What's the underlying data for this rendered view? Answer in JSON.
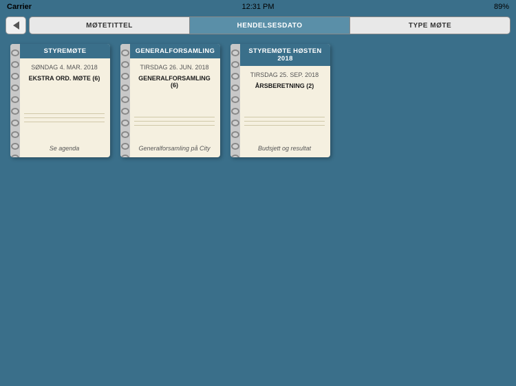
{
  "status_bar": {
    "carrier": "Carrier",
    "time": "12:31 PM",
    "battery": "89%"
  },
  "nav": {
    "back_label": "←",
    "tabs": [
      {
        "id": "motetittel",
        "label": "MØTETITTEL",
        "active": false
      },
      {
        "id": "hendelsesdato",
        "label": "HENDELSESDATO",
        "active": true
      },
      {
        "id": "type_mote",
        "label": "TYPE MØTE",
        "active": false
      }
    ]
  },
  "cards": [
    {
      "id": "card1",
      "title": "STYREMØTE",
      "date": "SØNDAG 4. MAR. 2018",
      "agenda_title": "EKSTRA ORD. MØTE (6)",
      "agenda_sub": "Se agenda",
      "rings": 13
    },
    {
      "id": "card2",
      "title": "GENERALFORSAMLING",
      "date": "TIRSDAG 26. JUN. 2018",
      "agenda_title": "GENERALFORSAMLING (6)",
      "agenda_sub": "Generalforsamling på City",
      "rings": 13
    },
    {
      "id": "card3",
      "title": "STYREMØTE HØSTEN 2018",
      "date": "TIRSDAG 25. SEP. 2018",
      "agenda_title": "ÅRSBERETNING (2)",
      "agenda_sub": "Budsjett og resultat",
      "rings": 13
    }
  ]
}
